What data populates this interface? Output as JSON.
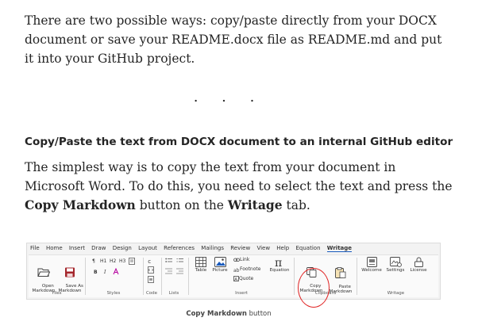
{
  "intro": {
    "text": "There are two possible ways: copy/paste directly from your DOCX document or save your README.docx file as README.md and put it into your GitHub project."
  },
  "separator": {
    "dots": ". . ."
  },
  "section": {
    "heading": "Copy/Paste the text from DOCX document to an internal GitHub editor",
    "text_before_button": "The simplest way is to copy the text from your document in Microsoft Word. To do this, you need to select the text and press the ",
    "button_name": "Copy Markdown",
    "text_mid": " button on the ",
    "tab_name": "Writage",
    "text_end": " tab."
  },
  "ribbon": {
    "tabs": [
      "File",
      "Home",
      "Insert",
      "Draw",
      "Design",
      "Layout",
      "References",
      "Mailings",
      "Review",
      "View",
      "Help",
      "Equation",
      "Writage"
    ],
    "active_tab": "Writage",
    "groups": {
      "files": "Files",
      "styles": "Styles",
      "code": "Code",
      "lists": "Lists",
      "insert": "Insert",
      "clipboard": "Clipboard",
      "writage": "Writage"
    },
    "buttons": {
      "open_markdown": "Open\nMarkdown",
      "save_as_markdown": "Save As\nMarkdown",
      "paragraph": "¶",
      "h1": "H1",
      "h2": "H2",
      "h3": "H3",
      "bold": "B",
      "italic": "I",
      "table": "Table",
      "picture": "Picture",
      "link": "Link",
      "footnote": "Footnote",
      "quote": "Quote",
      "equation": "Equation",
      "copy_markdown": "Copy\nMarkdown",
      "paste_markdown": "Paste\nMarkdown",
      "welcome": "Welcome",
      "settings": "Settings",
      "license": "License"
    },
    "colors": {
      "accent": "#185abd",
      "highlight": "#e02424",
      "save_icon": "#a4262c"
    }
  },
  "caption": {
    "bold": "Copy Markdown",
    "rest": " button"
  }
}
